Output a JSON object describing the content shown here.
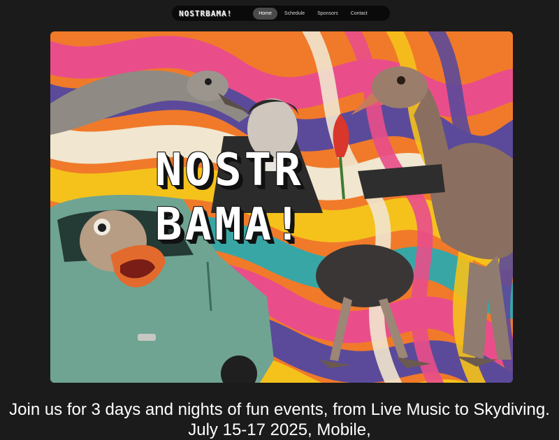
{
  "nav": {
    "logo": "NOSTRBAMA!",
    "links": [
      {
        "label": "Home",
        "active": true
      },
      {
        "label": "Schedule",
        "active": false
      },
      {
        "label": "Sponsors",
        "active": false
      },
      {
        "label": "Contact",
        "active": false
      }
    ]
  },
  "hero": {
    "title_line1": "NOSTR",
    "title_line2": "BAMA!"
  },
  "intro": {
    "text": "Join us for 3 days and nights of fun events, from Live Music to Skydiving. July 15-17 2025, Mobile,"
  },
  "colors": {
    "background": "#1b1b1b",
    "nav_bg": "#0a0a0a",
    "nav_active": "#4a4a4a",
    "swirl_pink": "#e94e8a",
    "swirl_orange": "#f07a2a",
    "swirl_yellow": "#f5c21b",
    "swirl_purple": "#5b4a9a",
    "swirl_teal": "#39a6a6",
    "swirl_cream": "#f1e6cf",
    "car_teal": "#6fa493"
  }
}
